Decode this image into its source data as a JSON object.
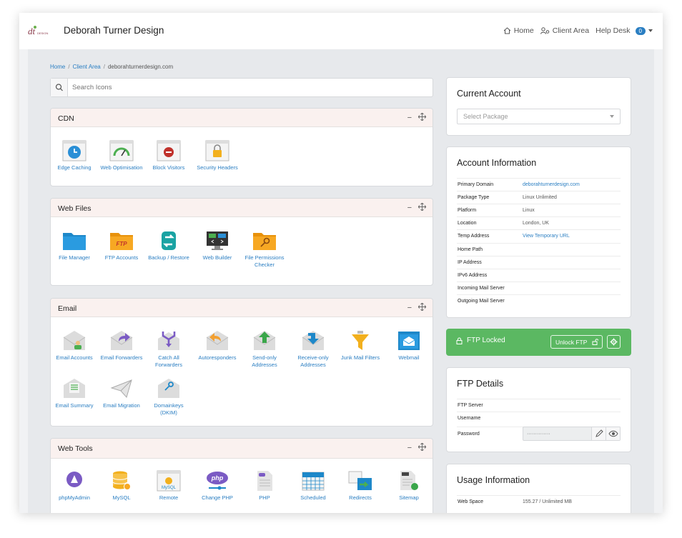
{
  "header": {
    "brand_name": "Deborah Turner Design",
    "logo_text": "DESIGN",
    "nav": {
      "home": "Home",
      "client_area": "Client Area",
      "help_desk": "Help Desk",
      "help_desk_count": "0"
    }
  },
  "breadcrumb": {
    "home": "Home",
    "client_area": "Client Area",
    "current": "deborahturnerdesign.com",
    "separator": "/"
  },
  "search": {
    "placeholder": "Search Icons"
  },
  "panels": {
    "cdn": {
      "title": "CDN",
      "tiles": [
        "Edge Caching",
        "Web Optimisation",
        "Block Visitors",
        "Security Headers"
      ]
    },
    "web_files": {
      "title": "Web Files",
      "tiles": [
        "File Manager",
        "FTP Accounts",
        "Backup / Restore",
        "Web Builder",
        "File Permissions Checker"
      ]
    },
    "email": {
      "title": "Email",
      "tiles": [
        "Email Accounts",
        "Email Forwarders",
        "Catch All Forwarders",
        "Autoresponders",
        "Send-only Addresses",
        "Receive-only Addresses",
        "Junk Mail Filters",
        "Webmail",
        "Email Summary",
        "Email Migration",
        "Domainkeys (DKIM)"
      ]
    },
    "web_tools": {
      "title": "Web Tools",
      "tiles": [
        "phpMyAdmin",
        "MySQL",
        "Remote",
        "Change PHP",
        "PHP",
        "Scheduled",
        "Redirects",
        "Sitemap"
      ]
    },
    "minimize_symbol": "−"
  },
  "current_account": {
    "title": "Current Account",
    "select_placeholder": "Select Package"
  },
  "account_info": {
    "title": "Account Information",
    "rows": [
      {
        "k": "Primary Domain",
        "v": "deborahturnerdesign.com"
      },
      {
        "k": "Package Type",
        "v": "Linux Unlimited"
      },
      {
        "k": "Platform",
        "v": "Linux"
      },
      {
        "k": "Location",
        "v": "London, UK"
      },
      {
        "k": "Temp Address",
        "v": "View Temporary URL"
      },
      {
        "k": "Home Path",
        "v": ""
      },
      {
        "k": "IP Address",
        "v": ""
      },
      {
        "k": "IPv6 Address",
        "v": ""
      },
      {
        "k": "Incoming Mail Server",
        "v": ""
      },
      {
        "k": "Outgoing Mail Server",
        "v": ""
      }
    ]
  },
  "ftp_lock": {
    "status": "FTP Locked",
    "unlock_label": "Unlock FTP"
  },
  "ftp_details": {
    "title": "FTP Details",
    "server_label": "FTP Server",
    "username_label": "Username",
    "password_label": "Password",
    "password_mask": "··············"
  },
  "usage": {
    "title": "Usage Information",
    "web_space_label": "Web Space",
    "web_space_value": "155.27 / Unlimited MB"
  },
  "colors": {
    "link": "#2a7ec2",
    "panel_header": "#faf1ef",
    "ftp_locked": "#5bb862"
  }
}
